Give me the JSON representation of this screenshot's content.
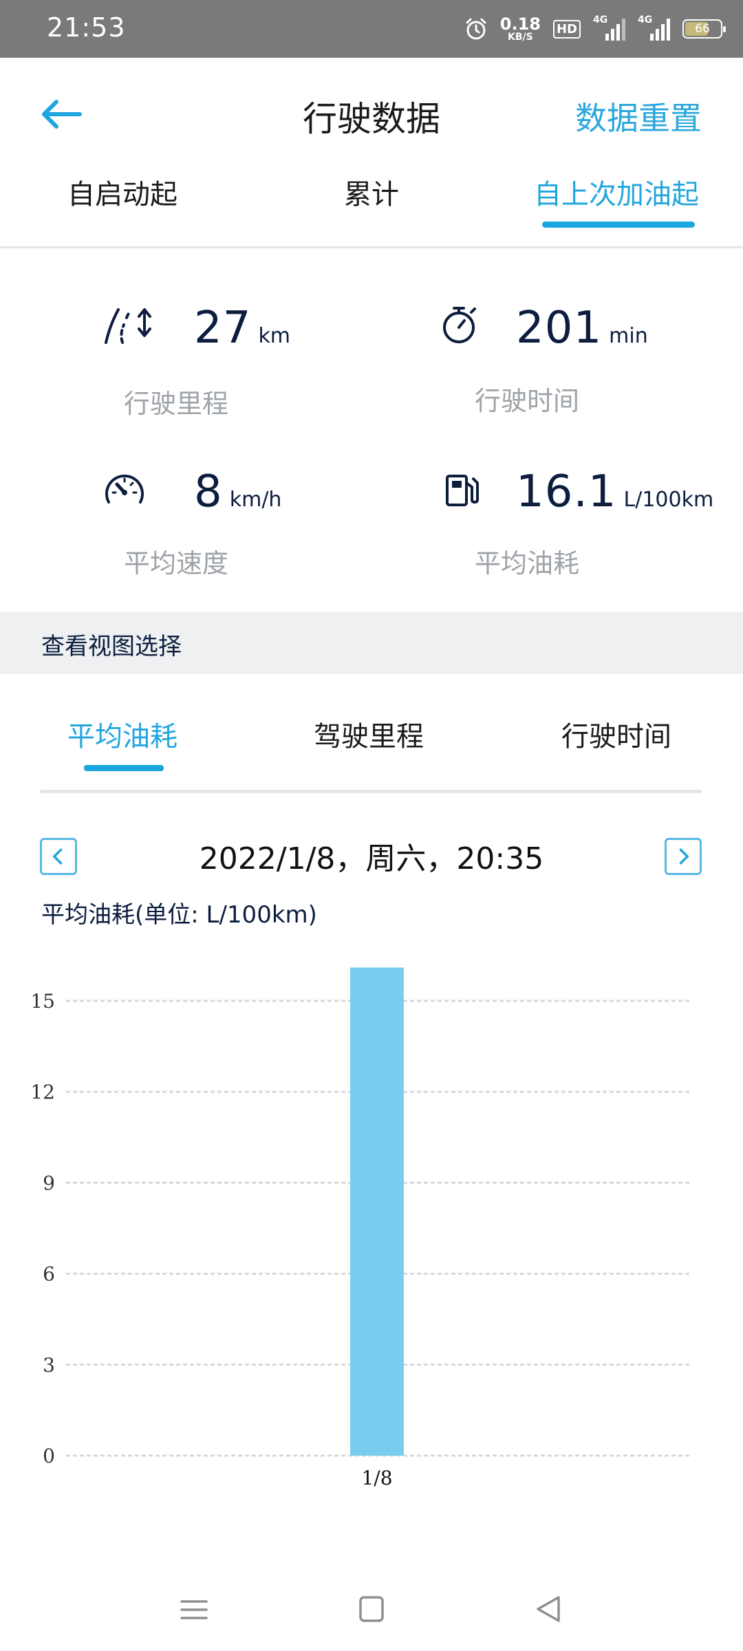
{
  "status_bar": {
    "time": "21:53",
    "net_speed_value": "0.18",
    "net_speed_unit": "KB/S",
    "hd_label": "HD",
    "sim1_label": "4G",
    "sim2_label": "4G",
    "battery": "66"
  },
  "header": {
    "title": "行驶数据",
    "reset_label": "数据重置",
    "back_icon": "arrow-left-icon"
  },
  "top_tabs": [
    {
      "label": "自启动起",
      "active": false
    },
    {
      "label": "累计",
      "active": false
    },
    {
      "label": "自上次加油起",
      "active": true
    }
  ],
  "stats": {
    "distance": {
      "value": "27",
      "unit": "km",
      "label": "行驶里程",
      "icon": "road-distance-icon"
    },
    "time": {
      "value": "201",
      "unit": "min",
      "label": "行驶时间",
      "icon": "stopwatch-icon"
    },
    "speed": {
      "value": "8",
      "unit": "km/h",
      "label": "平均速度",
      "icon": "speedometer-icon"
    },
    "fuel": {
      "value": "16.1",
      "unit": "L/100km",
      "label": "平均油耗",
      "icon": "fuel-pump-icon"
    }
  },
  "view_select_label": "查看视图选择",
  "sub_tabs": [
    {
      "label": "平均油耗",
      "active": true
    },
    {
      "label": "驾驶里程",
      "active": false
    },
    {
      "label": "行驶时间",
      "active": false
    }
  ],
  "date_nav": {
    "label": "2022/1/8，周六，20:35",
    "prev_icon": "chevron-left-icon",
    "next_icon": "chevron-right-icon"
  },
  "chart_title": "平均油耗(单位: L/100km)",
  "chart_data": {
    "type": "bar",
    "categories": [
      "1/8"
    ],
    "values": [
      16.1
    ],
    "ylim": [
      0,
      16.7
    ],
    "yticks": [
      0,
      3,
      6,
      9,
      12,
      15
    ],
    "grid": true,
    "bar_color": "#7acdee"
  },
  "colors": {
    "accent": "#22a6de",
    "dark_text": "#0c1d3e",
    "muted_text": "#9ea3a8"
  },
  "nav_bar": [
    "menu-icon",
    "home-square-icon",
    "back-triangle-icon"
  ]
}
